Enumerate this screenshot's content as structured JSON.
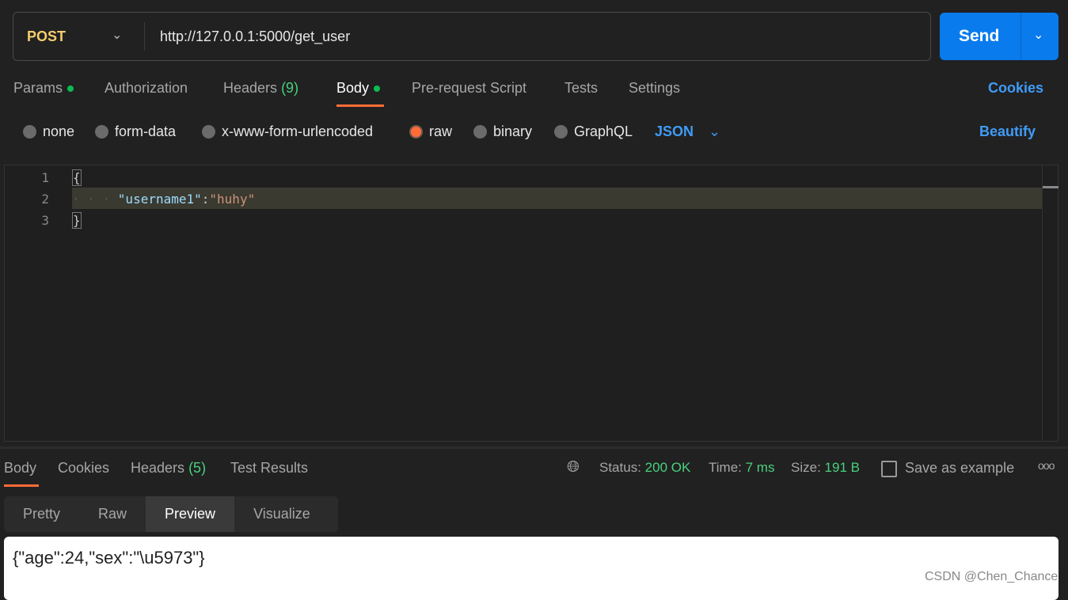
{
  "request": {
    "method": "POST",
    "url": "http://127.0.0.1:5000/get_user",
    "send_label": "Send"
  },
  "tabs": [
    {
      "label": "Params",
      "dot": true
    },
    {
      "label": "Authorization"
    },
    {
      "label": "Headers",
      "count": "(9)"
    },
    {
      "label": "Body",
      "dot": true,
      "active": true
    },
    {
      "label": "Pre-request Script"
    },
    {
      "label": "Tests"
    },
    {
      "label": "Settings"
    }
  ],
  "cookies_label": "Cookies",
  "body_types": [
    {
      "label": "none"
    },
    {
      "label": "form-data"
    },
    {
      "label": "x-www-form-urlencoded"
    },
    {
      "label": "raw",
      "selected": true
    },
    {
      "label": "binary"
    },
    {
      "label": "GraphQL"
    }
  ],
  "format": "JSON",
  "beautify_label": "Beautify",
  "editor": {
    "lines": [
      "1",
      "2",
      "3"
    ],
    "open": "{",
    "key": "\"username1\"",
    "colon": ":",
    "value": "\"huhy\"",
    "close": "}"
  },
  "response": {
    "tabs": [
      "Body",
      "Cookies",
      "Headers",
      "Test Results"
    ],
    "headers_count": "(5)",
    "status_label": "Status:",
    "status": "200 OK",
    "time_label": "Time:",
    "time": "7 ms",
    "size_label": "Size:",
    "size": "191 B",
    "save_label": "Save as example",
    "views": [
      "Pretty",
      "Raw",
      "Preview",
      "Visualize"
    ],
    "body": "{\"age\":24,\"sex\":\"\\u5973\"}"
  },
  "watermark": "CSDN @Chen_Chance",
  "colors": {
    "accent": "#ff6c37",
    "send": "#097bed",
    "link": "#3f9cf8",
    "success": "#49d17d",
    "method": "#f4ce6b"
  }
}
